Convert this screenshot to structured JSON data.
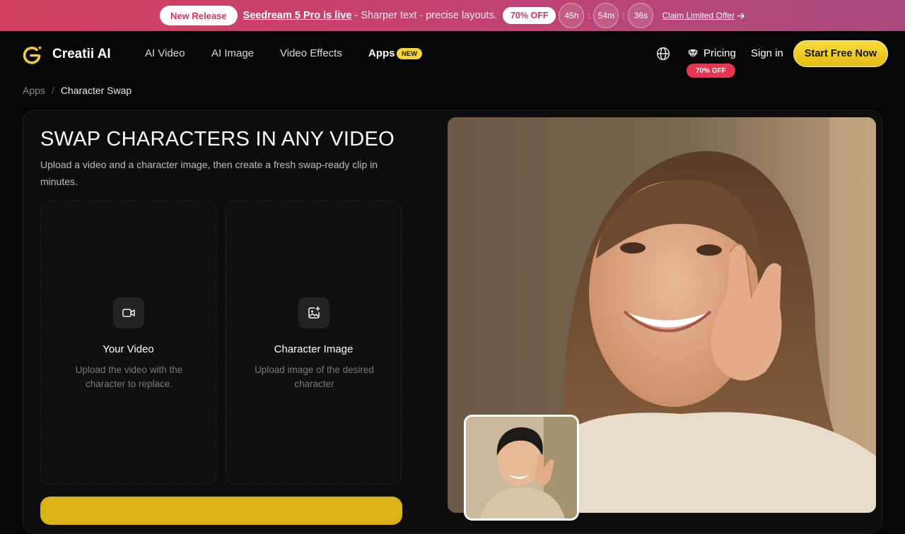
{
  "promo": {
    "new_release": "New Release",
    "link_text": "Seedream 5 Pro is live",
    "tagline": " - Sharper text · precise layouts.",
    "discount": "70% OFF",
    "timer": {
      "hours": "45h",
      "minutes": "54m",
      "seconds": "36s",
      "sep": ":"
    },
    "claim": "Claim Limited Offer"
  },
  "nav": {
    "brand": "Creatii AI",
    "items": [
      "AI Video",
      "AI Image",
      "Video Effects",
      "Apps"
    ],
    "apps_badge": "NEW",
    "pricing": "Pricing",
    "pricing_badge": "70% OFF",
    "signin": "Sign in",
    "cta": "Start Free Now",
    "icons": {
      "logo": "creatii-logo-icon",
      "globe": "globe-icon",
      "diamond": "diamond-icon",
      "arrow": "arrow-right-icon"
    }
  },
  "breadcrumb": {
    "parent": "Apps",
    "separator": "/",
    "current": "Character Swap"
  },
  "main": {
    "title": "SWAP CHARACTERS IN ANY VIDEO",
    "description": "Upload a video and a character image, then create a fresh swap-ready clip in minutes.",
    "uploads": [
      {
        "title": "Your Video",
        "subtitle": "Upload the video with the character to replace.",
        "icon": "video-camera-icon"
      },
      {
        "title": "Character Image",
        "subtitle": "Upload image of the desired character",
        "icon": "image-add-icon"
      }
    ]
  },
  "colors": {
    "accent": "#f2cf2b",
    "promo_gradient_start": "#d2425f",
    "promo_gradient_end": "#a84a7e",
    "badge_red": "#e8344f",
    "background": "#060606"
  }
}
